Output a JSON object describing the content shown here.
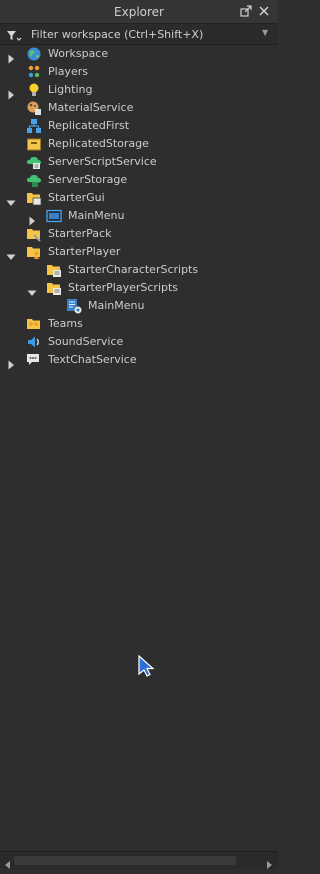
{
  "panel": {
    "title": "Explorer"
  },
  "filter": {
    "placeholder": "Filter workspace (Ctrl+Shift+X)"
  },
  "tree": [
    {
      "label": "Workspace",
      "icon": "globe-icon",
      "expander": "collapsed"
    },
    {
      "label": "Players",
      "icon": "players-icon",
      "expander": "none"
    },
    {
      "label": "Lighting",
      "icon": "lightbulb-icon",
      "expander": "collapsed"
    },
    {
      "label": "MaterialService",
      "icon": "material-service-icon",
      "expander": "none"
    },
    {
      "label": "ReplicatedFirst",
      "icon": "replicated-first-icon",
      "expander": "none"
    },
    {
      "label": "ReplicatedStorage",
      "icon": "replicated-storage-icon",
      "expander": "none"
    },
    {
      "label": "ServerScriptService",
      "icon": "server-script-service-icon",
      "expander": "none"
    },
    {
      "label": "ServerStorage",
      "icon": "server-storage-icon",
      "expander": "none"
    },
    {
      "label": "StarterGui",
      "icon": "starter-gui-icon",
      "expander": "expanded"
    },
    {
      "label": "MainMenu",
      "icon": "screen-gui-icon",
      "expander": "collapsed"
    },
    {
      "label": "StarterPack",
      "icon": "starter-pack-icon",
      "expander": "none"
    },
    {
      "label": "StarterPlayer",
      "icon": "starter-player-icon",
      "expander": "expanded"
    },
    {
      "label": "StarterCharacterScripts",
      "icon": "starter-character-scripts-icon",
      "expander": "none"
    },
    {
      "label": "StarterPlayerScripts",
      "icon": "starter-player-scripts-icon",
      "expander": "expanded"
    },
    {
      "label": "MainMenu",
      "icon": "local-script-icon",
      "expander": "none"
    },
    {
      "label": "Teams",
      "icon": "teams-icon",
      "expander": "none"
    },
    {
      "label": "SoundService",
      "icon": "sound-service-icon",
      "expander": "none"
    },
    {
      "label": "TextChatService",
      "icon": "text-chat-service-icon",
      "expander": "collapsed"
    }
  ]
}
